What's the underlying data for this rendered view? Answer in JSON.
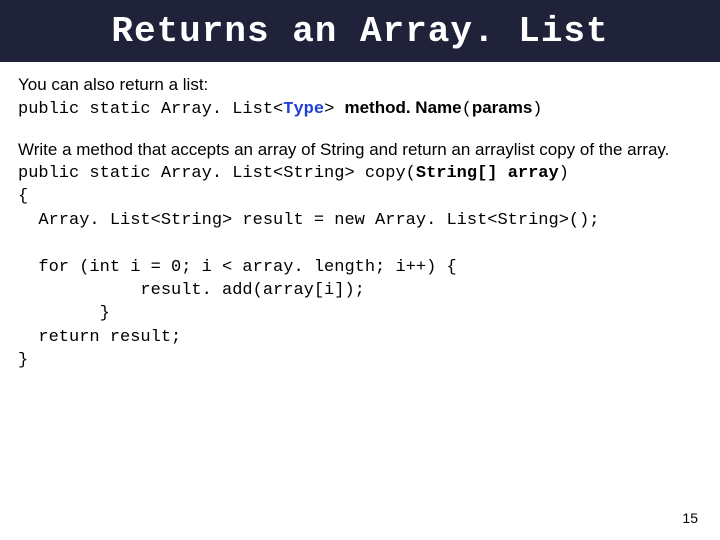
{
  "title": "Returns an Array. List",
  "intro_line": "You can also return a list:",
  "sig": {
    "prefix": "public static Array. List<",
    "type": "Type",
    "mid": "> ",
    "method": "method. Name",
    "paren_open": "(",
    "params": "params",
    "paren_close": ")"
  },
  "exercise_prompt": "Write a method that accepts an array of String and return an arraylist copy of the array.",
  "code": {
    "l1a": "public static Array. List<String> copy(",
    "l1b": "String[] array",
    "l1c": ")",
    "l2": "{",
    "l3": "  Array. List<String> result = new Array. List<String>();",
    "l4": "",
    "l5": "  for (int i = 0; i < array. length; i++) {",
    "l6": "            result. add(array[i]);",
    "l7": "        }",
    "l8": "  return result;",
    "l9": "}"
  },
  "page_number": "15"
}
